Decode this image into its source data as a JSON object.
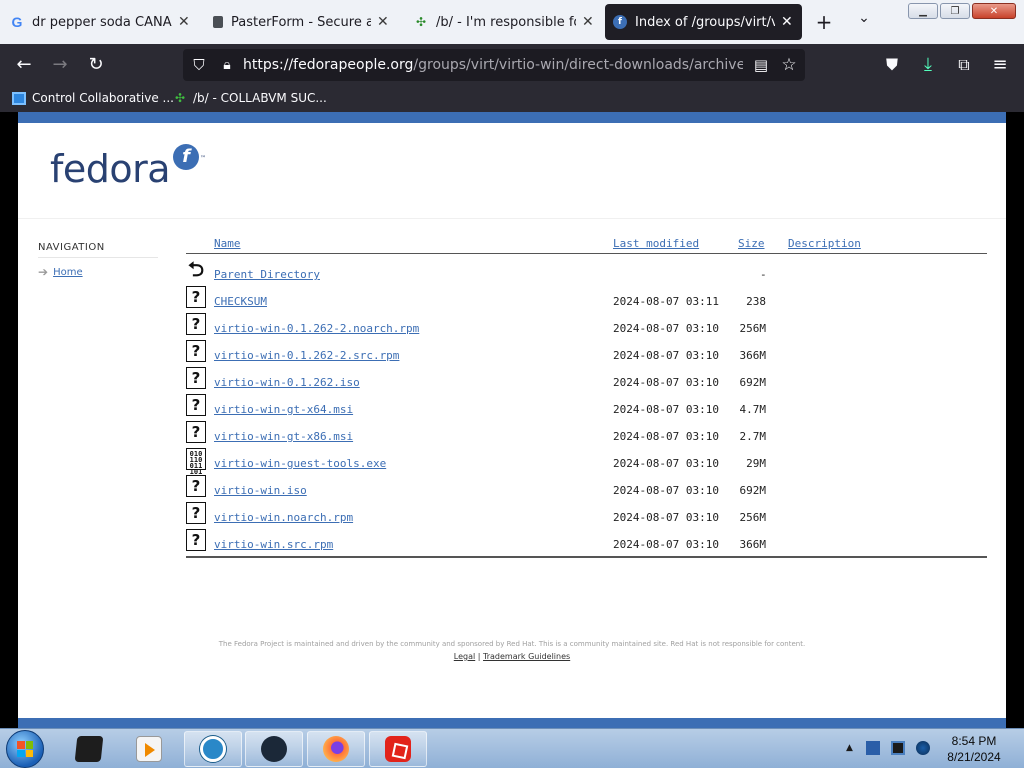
{
  "browser": {
    "tabs": [
      {
        "title": "dr pepper soda CANADA N",
        "favicon": "google-icon",
        "active": false
      },
      {
        "title": "PasterForm - Secure and A",
        "favicon": "document-icon",
        "active": false
      },
      {
        "title": "/b/ - I'm responsible for th",
        "favicon": "clover-icon",
        "active": false
      },
      {
        "title": "Index of /groups/virt/virti",
        "favicon": "fedora-icon",
        "active": true
      }
    ],
    "url_host": "https://fedorapeople.org",
    "url_path": "/groups/virt/virtio-win/direct-downloads/archive-virtio/vi",
    "bookmarks": [
      {
        "label": "Control Collaborative ...",
        "icon": "monitor-icon"
      },
      {
        "label": "/b/ - COLLABVM SUC...",
        "icon": "clover-icon"
      }
    ],
    "colors": {
      "chrome_dark": "#2b2a33",
      "url_bg": "#1c1b22",
      "tabstrip": "#eff2f7"
    }
  },
  "page": {
    "logo_text": "fedora",
    "logo_badge": "f",
    "logo_tm": "™",
    "navigation": {
      "heading": "NAVIGATION",
      "home_label": "Home"
    },
    "columns": {
      "name": "Name",
      "last_modified": "Last modified",
      "size": "Size",
      "description": "Description"
    },
    "parent": {
      "name": "Parent Directory",
      "size": "-",
      "icon": "back-arrow-icon"
    },
    "files": [
      {
        "name": "CHECKSUM",
        "modified": "2024-08-07 03:11",
        "size": "238",
        "icon": "unknown-file-icon"
      },
      {
        "name": "virtio-win-0.1.262-2.noarch.rpm",
        "modified": "2024-08-07 03:10",
        "size": "256M",
        "icon": "unknown-file-icon"
      },
      {
        "name": "virtio-win-0.1.262-2.src.rpm",
        "modified": "2024-08-07 03:10",
        "size": "366M",
        "icon": "unknown-file-icon"
      },
      {
        "name": "virtio-win-0.1.262.iso",
        "modified": "2024-08-07 03:10",
        "size": "692M",
        "icon": "unknown-file-icon"
      },
      {
        "name": "virtio-win-gt-x64.msi",
        "modified": "2024-08-07 03:10",
        "size": "4.7M",
        "icon": "unknown-file-icon"
      },
      {
        "name": "virtio-win-gt-x86.msi",
        "modified": "2024-08-07 03:10",
        "size": "2.7M",
        "icon": "unknown-file-icon"
      },
      {
        "name": "virtio-win-guest-tools.exe",
        "modified": "2024-08-07 03:10",
        "size": "29M",
        "icon": "binary-file-icon"
      },
      {
        "name": "virtio-win.iso",
        "modified": "2024-08-07 03:10",
        "size": "692M",
        "icon": "unknown-file-icon"
      },
      {
        "name": "virtio-win.noarch.rpm",
        "modified": "2024-08-07 03:10",
        "size": "256M",
        "icon": "unknown-file-icon"
      },
      {
        "name": "virtio-win.src.rpm",
        "modified": "2024-08-07 03:10",
        "size": "366M",
        "icon": "unknown-file-icon"
      }
    ],
    "footer_text": "The Fedora Project is maintained and driven by the community and sponsored by Red Hat. This is a community maintained site. Red Hat is not responsible for content.",
    "footer_links": [
      {
        "label": "Legal"
      },
      {
        "label": "Trademark Guidelines"
      }
    ],
    "footer_sep": "|",
    "colors": {
      "brand_blue": "#3c6eb4",
      "logo_navy": "#294172"
    }
  },
  "taskbar": {
    "apps": [
      "command-prompt-icon",
      "media-player-icon",
      "ring-app-icon",
      "steam-icon",
      "firefox-icon",
      "roblox-icon"
    ],
    "clock_time": "8:54 PM",
    "clock_date": "8/21/2024"
  }
}
